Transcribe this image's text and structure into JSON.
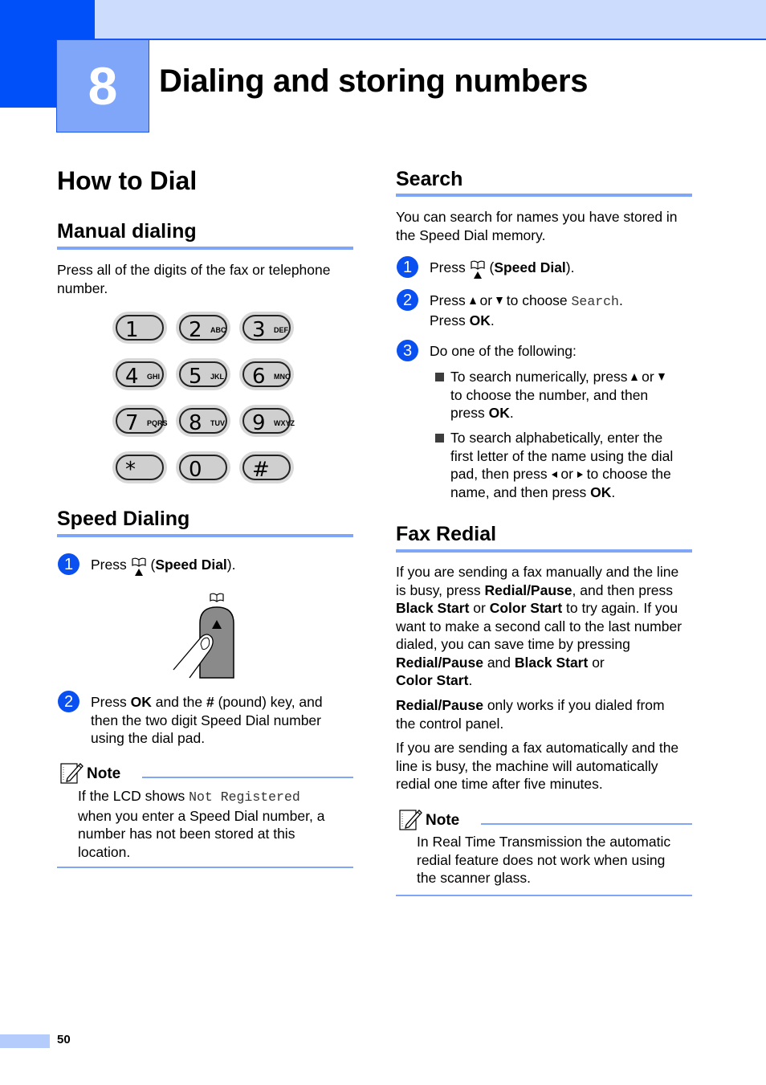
{
  "chapter": {
    "number": "8",
    "title": "Dialing and storing numbers"
  },
  "left": {
    "section_title": "How to Dial",
    "manual": {
      "heading": "Manual dialing",
      "text_line1": "Press all of the digits of the fax or telephone",
      "text_line2": "number."
    },
    "keypad": [
      {
        "digit": "1",
        "letters": ""
      },
      {
        "digit": "2",
        "letters": "ABC"
      },
      {
        "digit": "3",
        "letters": "DEF"
      },
      {
        "digit": "4",
        "letters": "GHI"
      },
      {
        "digit": "5",
        "letters": "JKL"
      },
      {
        "digit": "6",
        "letters": "MNO"
      },
      {
        "digit": "7",
        "letters": "PQRS"
      },
      {
        "digit": "8",
        "letters": "TUV"
      },
      {
        "digit": "9",
        "letters": "WXYZ"
      },
      {
        "digit": "*",
        "letters": ""
      },
      {
        "digit": "0",
        "letters": ""
      },
      {
        "digit": "#",
        "letters": ""
      }
    ],
    "speed": {
      "heading": "Speed Dialing",
      "step1": {
        "num": "1",
        "pre": "Press",
        "open": "(",
        "bold": "Speed Dial",
        "post": ")."
      },
      "step2": {
        "num": "2",
        "l1_a": "Press ",
        "l1_b": "OK",
        "l1_c": " and the ",
        "l1_d": "#",
        "l1_e": " (pound) key, and",
        "l2": "then the two digit Speed Dial number",
        "l3": "using the dial pad."
      },
      "note": {
        "title": "Note",
        "l1_a": "If the LCD shows ",
        "l1_mono": "Not Registered",
        "l2": "when you enter a Speed Dial number, a",
        "l3": "number has not been stored at this",
        "l4": "location."
      }
    }
  },
  "right": {
    "search": {
      "heading": "Search",
      "intro_l1": "You can search for names you have stored in",
      "intro_l2": "the Speed Dial memory.",
      "step1": {
        "num": "1",
        "pre": "Press",
        "open": "(",
        "bold": "Speed Dial",
        "post": ")."
      },
      "step2": {
        "num": "2",
        "a": "Press ",
        "b": " or ",
        "c": " to choose ",
        "mono": "Search",
        "d": ".",
        "l2_a": "Press ",
        "l2_b": "OK",
        "l2_c": "."
      },
      "step3": {
        "num": "3",
        "text": "Do one of the following:"
      },
      "bullet1": {
        "l1_a": "To search numerically, press ",
        "l1_b": " or ",
        "l2": "to choose the number, and then",
        "l3_a": "press ",
        "l3_b": "OK",
        "l3_c": "."
      },
      "bullet2": {
        "l1": "To search alphabetically, enter the",
        "l2": "first letter of the name using the dial",
        "l3_a": "pad, then press ",
        "l3_b": " or ",
        "l3_c": " to choose the",
        "l4_a": "name, and then press ",
        "l4_b": "OK",
        "l4_c": "."
      }
    },
    "fax_redial": {
      "heading": "Fax Redial",
      "p1": {
        "l1": "If you are sending a fax manually and the line",
        "l2_a": "is busy, press ",
        "l2_b": "Redial/Pause",
        "l2_c": ", and then press",
        "l3_a": "Black Start",
        "l3_b": " or ",
        "l3_c": "Color Start",
        "l3_d": " to try again. If you",
        "l4": "want to make a second call to the last number",
        "l5": "dialed, you can save time by pressing",
        "l6_a": "Redial/Pause",
        "l6_b": " and ",
        "l6_c": "Black Start",
        "l6_d": " or",
        "l7_a": "Color Start",
        "l7_b": "."
      },
      "p2": {
        "l1_a": "Redial/Pause",
        "l1_b": " only works if you dialed from",
        "l2": "the control panel."
      },
      "p3": {
        "l1": "If you are sending a fax automatically and the",
        "l2": "line is busy, the machine will automatically",
        "l3": "redial one time after five minutes."
      },
      "note": {
        "title": "Note",
        "l1": "In Real Time Transmission the automatic",
        "l2": "redial feature does not work when using",
        "l3": "the scanner glass."
      }
    }
  },
  "footer": {
    "page_number": "50"
  },
  "colors": {
    "accent_blue": "#0050fa",
    "rule_blue": "#80a6f8",
    "header_light": "#ccdcfc"
  }
}
